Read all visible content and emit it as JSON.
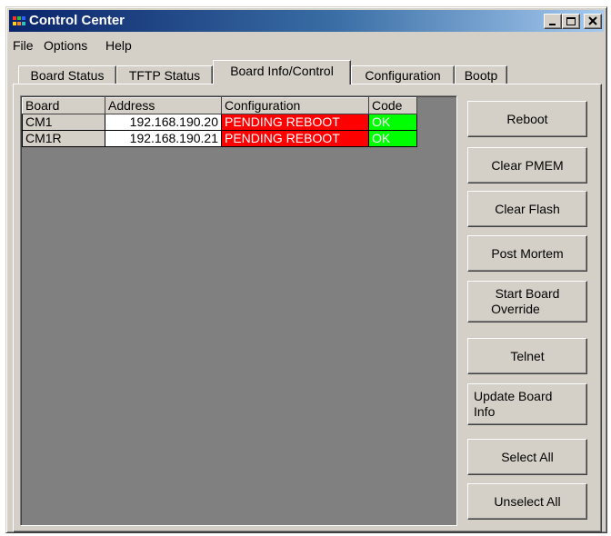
{
  "window": {
    "title": "Control Center"
  },
  "menu": [
    "File",
    "Options",
    "Help"
  ],
  "tabs": [
    "Board Status",
    "TFTP Status",
    "Board Info/Control",
    "Configuration",
    "Bootp"
  ],
  "active_tab": "Board Info/Control",
  "grid": {
    "columns": [
      "Board",
      "Address",
      "Configuration",
      "Code"
    ],
    "rows": [
      {
        "board": "CM1",
        "address": "192.168.190.20",
        "configuration": "PENDING REBOOT",
        "code": "OK"
      },
      {
        "board": "CM1R",
        "address": "192.168.190.21",
        "configuration": "PENDING REBOOT",
        "code": "OK"
      }
    ]
  },
  "buttons": {
    "reboot": "Reboot",
    "clear_pmem": "Clear PMEM",
    "clear_flash": "Clear Flash",
    "post_mortem": "Post Mortem",
    "start_board_override_1": "Start Board",
    "start_board_override_2": "Override",
    "telnet": "Telnet",
    "update_board_info_1": "Update Board",
    "update_board_info_2": "Info",
    "select_all": "Select All",
    "unselect_all": "Unselect All"
  },
  "colors": {
    "pending": "#ff0000",
    "ok": "#00ff00",
    "title_start": "#0a246a",
    "title_end": "#a6caf0"
  },
  "icons": {
    "app": "app-icon",
    "minimize": "minimize-icon",
    "maximize": "maximize-icon",
    "close": "close-icon"
  }
}
